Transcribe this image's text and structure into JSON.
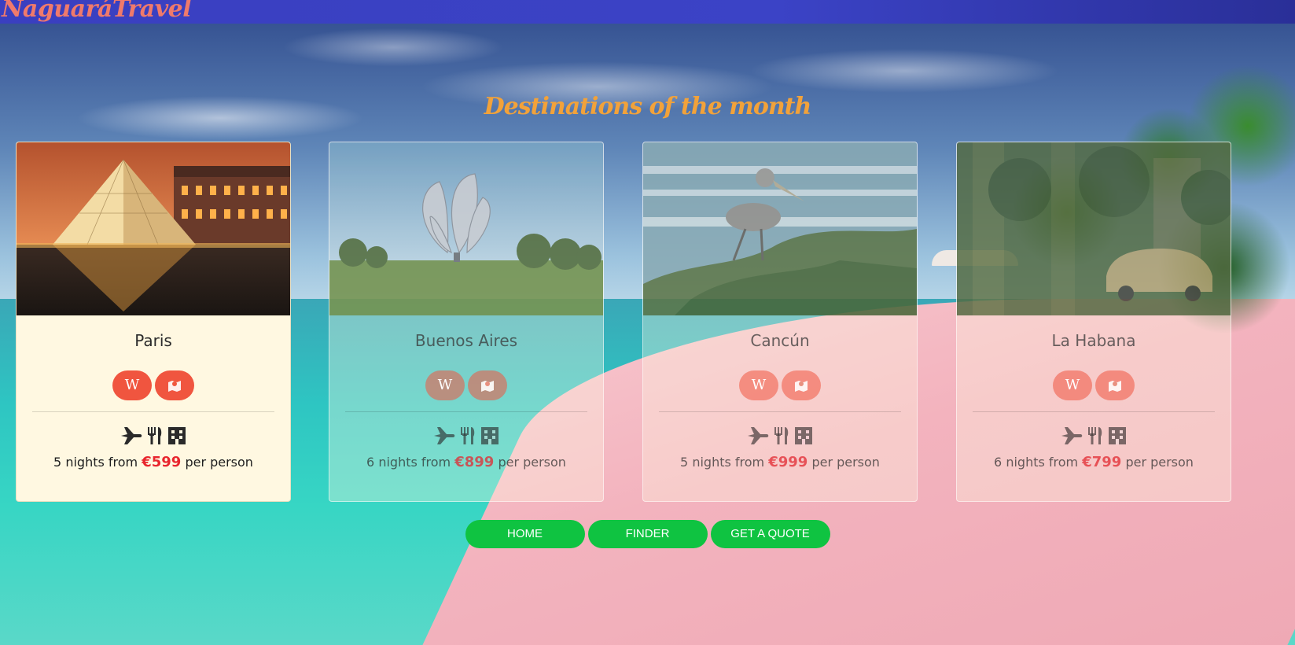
{
  "brand": {
    "logo_text": "NaguaráTravel"
  },
  "section": {
    "title": "Destinations of the month"
  },
  "cards": [
    {
      "name": "Paris",
      "nights": "5",
      "price": "€599",
      "wiki_label": "W"
    },
    {
      "name": "Buenos Aires",
      "nights": "6",
      "price": "€899",
      "wiki_label": "W"
    },
    {
      "name": "Cancún",
      "nights": "5",
      "price": "€999",
      "wiki_label": "W"
    },
    {
      "name": "La Habana",
      "nights": "6",
      "price": "€799",
      "wiki_label": "W"
    }
  ],
  "price_text": {
    "prefix": "nights from",
    "suffix": "per person"
  },
  "nav": {
    "home": "HOME",
    "finder": "FINDER",
    "quote": "GET A QUOTE"
  },
  "icons": {
    "wiki": "wikipedia-icon",
    "map": "map-marker-icon",
    "flight": "airplane-icon",
    "food": "utensils-icon",
    "hotel": "hotel-icon"
  },
  "colors": {
    "header": "#3b43c6",
    "logo": "#f07a6b",
    "title": "#f2a23a",
    "accent": "#f0553f",
    "price": "#e8262e",
    "nav_button": "#0fc341",
    "card_bg": "#fff8e1"
  }
}
